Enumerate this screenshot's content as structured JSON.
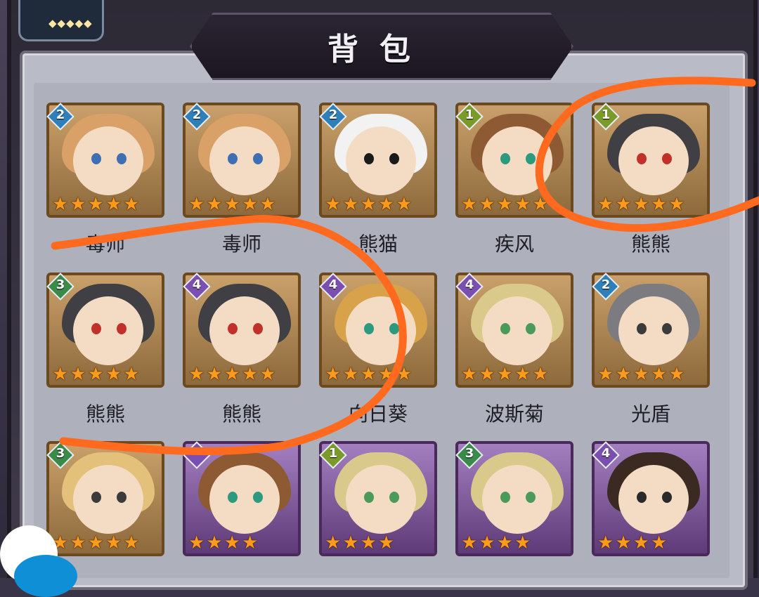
{
  "title": "背包",
  "colors": {
    "annotation": "#ff6a1f",
    "star": "#ff9a1a"
  },
  "cards": [
    {
      "name": "毒师",
      "level": "2",
      "stars": 5,
      "frame": "gold",
      "hair": "#d9a067",
      "eye": "#3e6fb3"
    },
    {
      "name": "毒师",
      "level": "2",
      "stars": 5,
      "frame": "gold",
      "hair": "#d9a067",
      "eye": "#3e6fb3"
    },
    {
      "name": "熊猫",
      "level": "2",
      "stars": 5,
      "frame": "gold",
      "hair": "#f2f2f2",
      "eye": "#1a1a1a"
    },
    {
      "name": "疾风",
      "level": "1",
      "stars": 5,
      "frame": "gold",
      "hair": "#8d5a34",
      "eye": "#2b9a7f"
    },
    {
      "name": "熊熊",
      "level": "1",
      "stars": 5,
      "frame": "gold",
      "hair": "#3f3f44",
      "eye": "#c2302a"
    },
    {
      "name": "熊熊",
      "level": "3",
      "stars": 5,
      "frame": "gold",
      "hair": "#3f3f44",
      "eye": "#c2302a"
    },
    {
      "name": "熊熊",
      "level": "4",
      "stars": 5,
      "frame": "gold",
      "hair": "#3f3f44",
      "eye": "#c2302a"
    },
    {
      "name": "向日葵",
      "level": "4",
      "stars": 5,
      "frame": "gold",
      "hair": "#d8a24a",
      "eye": "#2b9a7f"
    },
    {
      "name": "波斯菊",
      "level": "4",
      "stars": 5,
      "frame": "gold",
      "hair": "#d9c98a",
      "eye": "#4c9a5a"
    },
    {
      "name": "光盾",
      "level": "2",
      "stars": 5,
      "frame": "gold",
      "hair": "#7b7b80",
      "eye": "#3b3b3b"
    },
    {
      "name": "",
      "level": "3",
      "stars": 5,
      "frame": "gold",
      "hair": "#e3c17a",
      "eye": "#3b3b3b"
    },
    {
      "name": "",
      "level": "",
      "stars": 4,
      "frame": "purple",
      "hair": "#8d5a34",
      "eye": "#2b9a7f"
    },
    {
      "name": "",
      "level": "1",
      "stars": 4,
      "frame": "purple",
      "hair": "#d9c98a",
      "eye": "#4c9a5a"
    },
    {
      "name": "",
      "level": "3",
      "stars": 4,
      "frame": "purple",
      "hair": "#d9c98a",
      "eye": "#4c9a5a"
    },
    {
      "name": "",
      "level": "4",
      "stars": 4,
      "frame": "purple",
      "hair": "#3b2a22",
      "eye": "#2a2a2a"
    }
  ]
}
